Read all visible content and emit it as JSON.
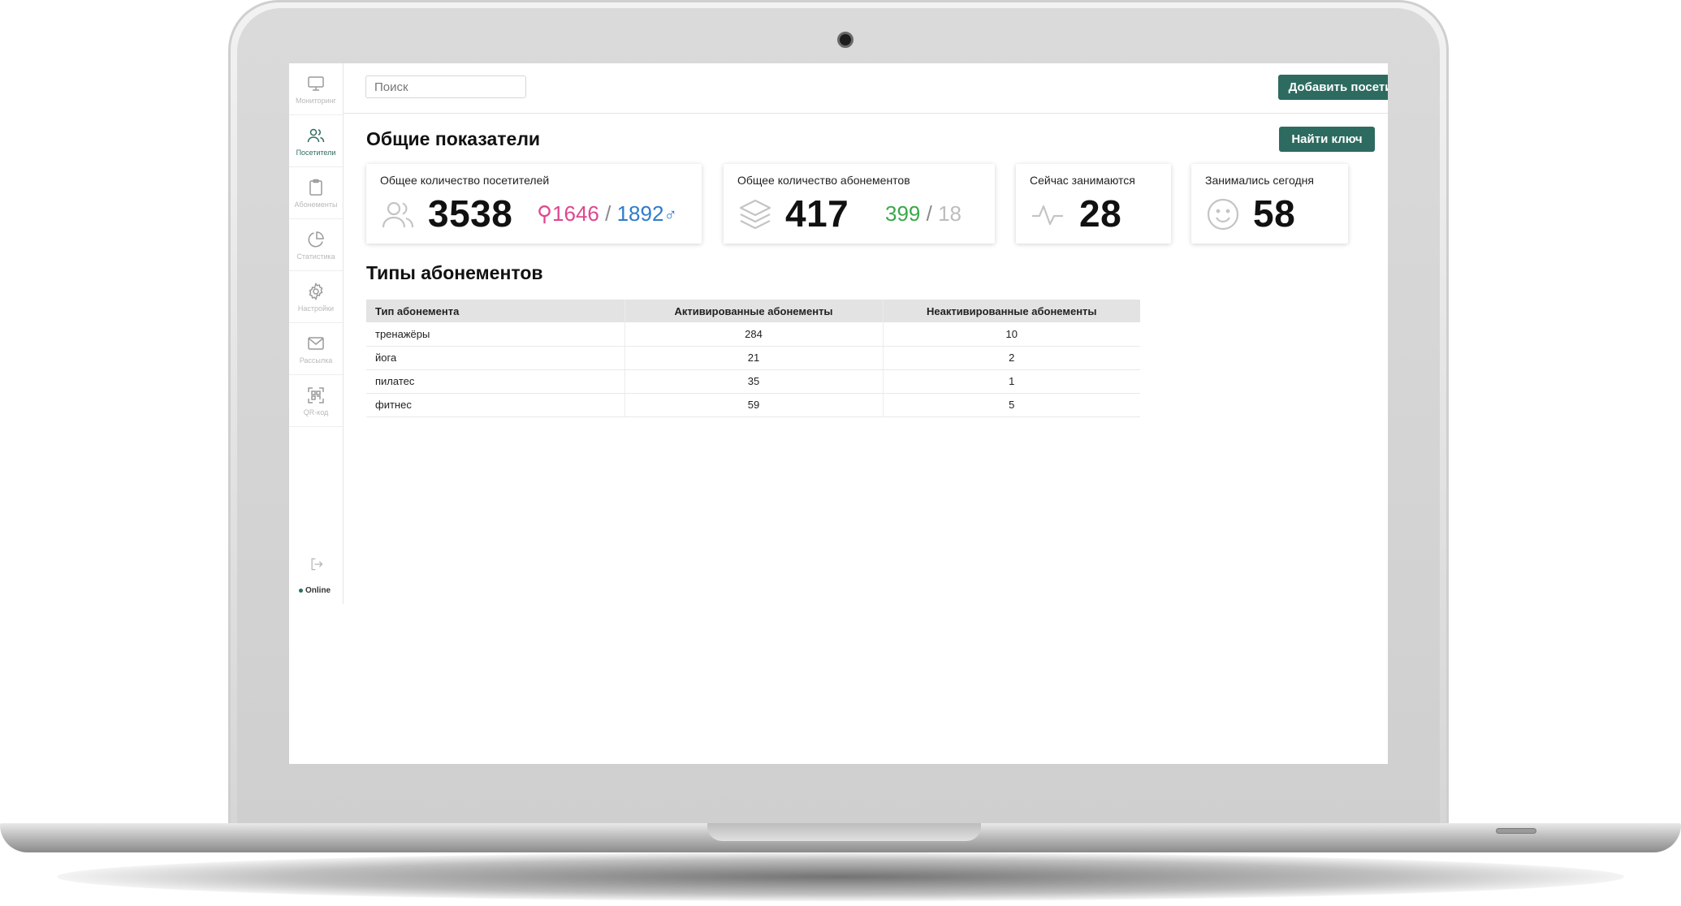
{
  "sidebar": {
    "items": [
      {
        "label": "Мониторинг",
        "icon": "monitor-icon"
      },
      {
        "label": "Посетители",
        "icon": "users-icon",
        "active": true
      },
      {
        "label": "Абонементы",
        "icon": "clipboard-icon"
      },
      {
        "label": "Статистика",
        "icon": "pie-chart-icon"
      },
      {
        "label": "Настройки",
        "icon": "gear-icon"
      },
      {
        "label": "Рассылка",
        "icon": "mail-icon"
      },
      {
        "label": "QR-код",
        "icon": "qr-scan-icon"
      }
    ],
    "status": "Online"
  },
  "search": {
    "placeholder": "Поиск"
  },
  "header": {
    "add_button": "Добавить посетителя"
  },
  "overview": {
    "title": "Общие показатели",
    "find_key_button": "Найти ключ",
    "cards": {
      "visitors": {
        "title": "Общее количество посетителей",
        "value": "3538",
        "female": "1646",
        "male": "1892",
        "separator": "/"
      },
      "memberships": {
        "title": "Общее количество абонементов",
        "value": "417",
        "active": "399",
        "inactive": "18",
        "separator": "/"
      },
      "now": {
        "title": "Сейчас занимаются",
        "value": "28"
      },
      "today": {
        "title": "Занимались сегодня",
        "value": "58"
      }
    }
  },
  "types": {
    "title": "Типы абонементов",
    "columns": [
      "Тип абонемента",
      "Активированные абонементы",
      "Неактивированные абонементы"
    ],
    "rows": [
      [
        "тренажёры",
        "284",
        "10"
      ],
      [
        "йога",
        "21",
        "2"
      ],
      [
        "пилатес",
        "35",
        "1"
      ],
      [
        "фитнес",
        "59",
        "5"
      ]
    ]
  },
  "colors": {
    "accent": "#2d6b60",
    "female": "#e0468f",
    "male": "#2e7ccc",
    "active": "#3aa84a",
    "inactive": "#bdbdbd"
  }
}
